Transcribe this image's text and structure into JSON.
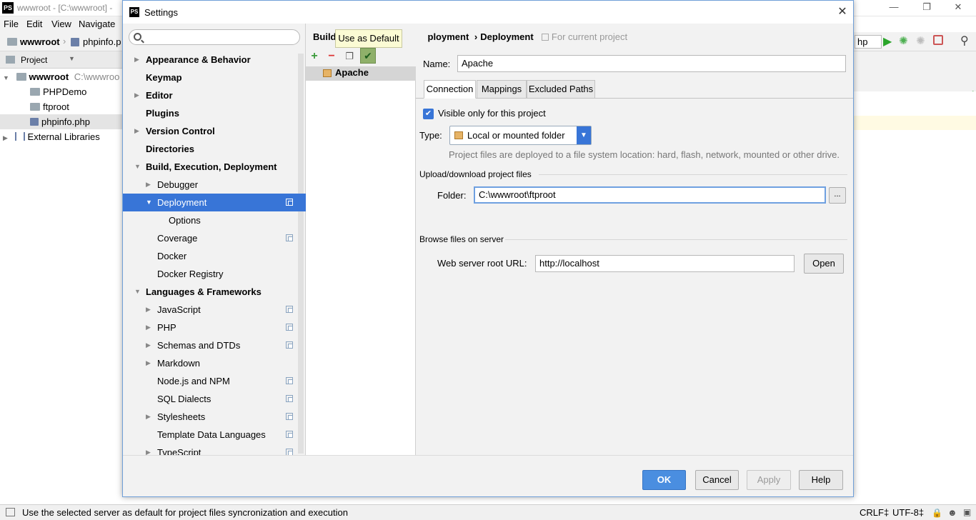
{
  "ide": {
    "window_title": "wwwroot - [C:\\wwwroot] -",
    "menu": [
      "File",
      "Edit",
      "View",
      "Navigate"
    ],
    "nav_root": "wwwroot",
    "nav_file": "phpinfo.p",
    "project_label": "Project",
    "tree": {
      "root": "wwwroot",
      "root_path": "C:\\wwwroo",
      "items": [
        "PHPDemo",
        "ftproot",
        "phpinfo.php"
      ],
      "external": "External Libraries"
    },
    "run_config": "hp",
    "status_message": "Use the selected server as default for project files syncronization and execution",
    "status_right": {
      "line_sep": "CRLF‡",
      "encoding": "UTF-8‡"
    }
  },
  "dialog": {
    "title": "Settings",
    "search_placeholder": "",
    "nav": [
      {
        "label": "Appearance & Behavior",
        "bold": true,
        "arrow": "right"
      },
      {
        "label": "Keymap",
        "bold": true
      },
      {
        "label": "Editor",
        "bold": true,
        "arrow": "right"
      },
      {
        "label": "Plugins",
        "bold": true
      },
      {
        "label": "Version Control",
        "bold": true,
        "arrow": "right"
      },
      {
        "label": "Directories",
        "bold": true
      },
      {
        "label": "Build, Execution, Deployment",
        "bold": true,
        "arrow": "down"
      },
      {
        "label": "Debugger",
        "arrow": "right"
      },
      {
        "label": "Deployment",
        "arrow": "down",
        "selected": true,
        "copy": true
      },
      {
        "label": "Options"
      },
      {
        "label": "Coverage",
        "copy": true
      },
      {
        "label": "Docker"
      },
      {
        "label": "Docker Registry"
      },
      {
        "label": "Languages & Frameworks",
        "bold": true,
        "arrow": "down"
      },
      {
        "label": "JavaScript",
        "arrow": "right",
        "copy": true
      },
      {
        "label": "PHP",
        "arrow": "right",
        "copy": true
      },
      {
        "label": "Schemas and DTDs",
        "arrow": "right",
        "copy": true
      },
      {
        "label": "Markdown",
        "arrow": "right"
      },
      {
        "label": "Node.js and NPM",
        "copy": true
      },
      {
        "label": "SQL Dialects",
        "copy": true
      },
      {
        "label": "Stylesheets",
        "arrow": "right",
        "copy": true
      },
      {
        "label": "Template Data Languages",
        "copy": true
      },
      {
        "label": "TypeScript",
        "arrow": "right",
        "copy": true
      }
    ],
    "breadcrumb": {
      "first": "Build",
      "middle": "ployment",
      "sep": "›",
      "last": "Deployment",
      "scope": "For current project"
    },
    "tooltip": "Use as Default",
    "server": "Apache",
    "name_label": "Name:",
    "name_value": "Apache",
    "tabs": [
      "Connection",
      "Mappings",
      "Excluded Paths"
    ],
    "visible_only_label": "Visible only for this project",
    "visible_only_checked": true,
    "type_label": "Type:",
    "type_value": "Local or mounted folder",
    "type_hint": "Project files are deployed to a file system location: hard, flash, network, mounted or other drive.",
    "upload_section": "Upload/download project files",
    "folder_label": "Folder:",
    "folder_value": "C:\\wwwroot\\ftproot",
    "browse_button": "...",
    "browse_section": "Browse files on server",
    "web_root_label": "Web server root URL:",
    "web_root_value": "http://localhost",
    "open_button": "Open",
    "buttons": {
      "ok": "OK",
      "cancel": "Cancel",
      "apply": "Apply",
      "help": "Help"
    }
  },
  "colors": {
    "accent": "#3875d7",
    "primary_button": "#4a8ee0",
    "tooltip_bg": "#fbfbd4"
  }
}
